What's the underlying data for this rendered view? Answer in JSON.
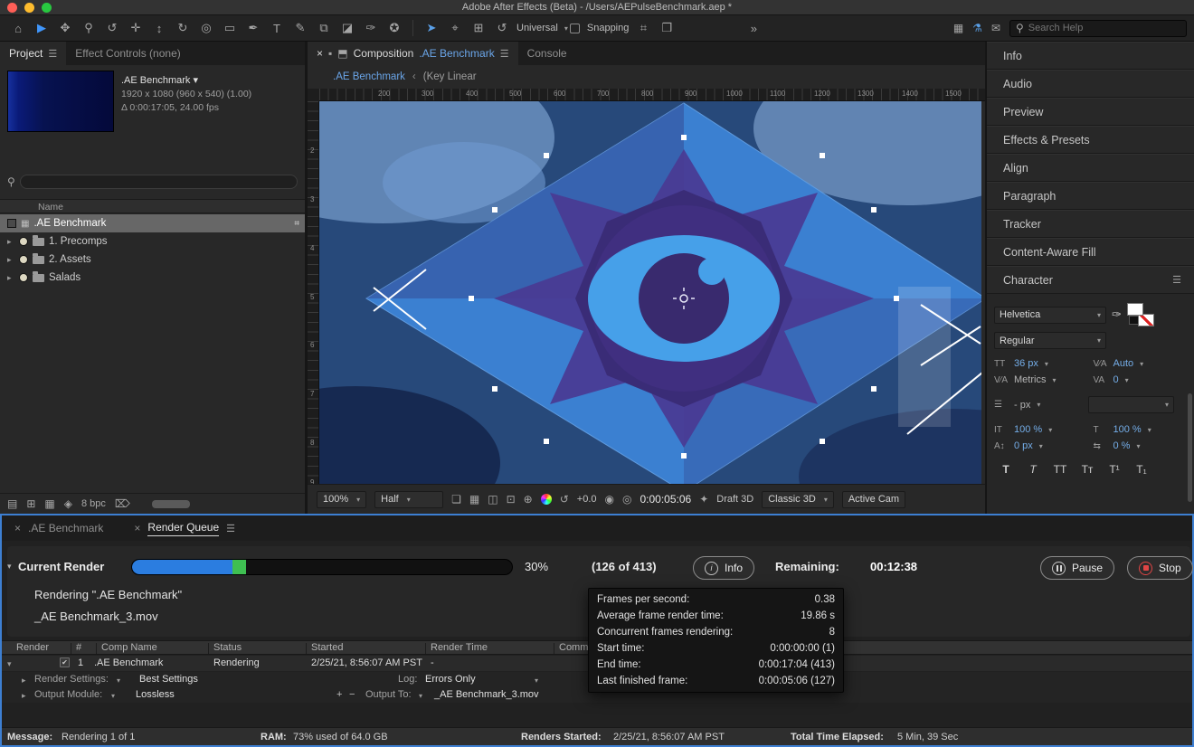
{
  "titlebar": {
    "title": "Adobe After Effects (Beta) - /Users/AEPulseBenchmark.aep *"
  },
  "toolbar": {
    "tools": [
      {
        "name": "home",
        "glyph": "⌂"
      },
      {
        "name": "selection",
        "glyph": "▶"
      },
      {
        "name": "hand",
        "glyph": "✥"
      },
      {
        "name": "zoom",
        "glyph": "⚲"
      },
      {
        "name": "orbit-camera",
        "glyph": "↺"
      },
      {
        "name": "pan-camera",
        "glyph": "✛"
      },
      {
        "name": "dolly-camera",
        "glyph": "↕"
      },
      {
        "name": "rotate",
        "glyph": "↻"
      },
      {
        "name": "pan-behind",
        "glyph": "◎"
      },
      {
        "name": "shape",
        "glyph": "▭"
      },
      {
        "name": "pen",
        "glyph": "✒"
      },
      {
        "name": "type",
        "glyph": "T"
      },
      {
        "name": "brush",
        "glyph": "✎"
      },
      {
        "name": "clone-stamp",
        "glyph": "⧉"
      },
      {
        "name": "eraser",
        "glyph": "◪"
      },
      {
        "name": "roto-brush",
        "glyph": "✑"
      },
      {
        "name": "puppet-pin",
        "glyph": "✪"
      }
    ],
    "axis_tools": [
      {
        "name": "selection-cursor",
        "glyph": "➤"
      },
      {
        "name": "local-axis-mode",
        "glyph": "⌖"
      },
      {
        "name": "world-axis-mode",
        "glyph": "⊞"
      },
      {
        "name": "reset-rotation",
        "glyph": "↺"
      }
    ],
    "universal_label": "Universal",
    "snapping_label": "Snapping",
    "snap_icons": [
      {
        "name": "snap-edges",
        "glyph": "⌗"
      },
      {
        "name": "snap-3d",
        "glyph": "❒"
      }
    ],
    "overflow": "»",
    "right_icons": [
      {
        "name": "workspace",
        "glyph": "▦"
      },
      {
        "name": "beta-feedback",
        "glyph": "⚗"
      },
      {
        "name": "comments",
        "glyph": "✉"
      }
    ],
    "search_placeholder": "Search Help"
  },
  "project_panel": {
    "tab_project": "Project",
    "tab_effect_controls": "Effect Controls (none)",
    "comp_name": ".AE Benchmark ▾",
    "comp_dimensions": "1920 x 1080  (960 x 540) (1.00)",
    "comp_duration": "Δ 0:00:17:05, 24.00 fps",
    "name_column": "Name",
    "items": [
      {
        "label": ".AE Benchmark",
        "type": "composition"
      },
      {
        "label": "1. Precomps",
        "type": "folder"
      },
      {
        "label": "2. Assets",
        "type": "folder"
      },
      {
        "label": "Salads",
        "type": "folder"
      }
    ],
    "bpc": "8 bpc"
  },
  "composition": {
    "tab_label": "Composition",
    "tab_comp_name": ".AE Benchmark",
    "tab_console": "Console",
    "breadcrumb_comp": ".AE Benchmark",
    "breadcrumb_sep": "‹",
    "breadcrumb_extra": "(Key Linear",
    "ruler_h": [
      "200",
      "300",
      "400",
      "500",
      "600",
      "700",
      "800",
      "900",
      "1000",
      "1100",
      "1200",
      "1300",
      "1400",
      "1500"
    ],
    "ruler_v": [
      "2",
      "3",
      "4",
      "5",
      "6",
      "7",
      "8",
      "9"
    ],
    "zoom": "100%",
    "resolution": "Half",
    "exposure": "+0.0",
    "timecode": "0:00:05:06",
    "draft_3d": "Draft 3D",
    "renderer": "Classic 3D",
    "camera": "Active Cam"
  },
  "right_dock": {
    "panels": [
      "Info",
      "Audio",
      "Preview",
      "Effects & Presets",
      "Align",
      "Paragraph",
      "Tracker",
      "Content-Aware Fill",
      "Character"
    ],
    "character": {
      "font_family": "Helvetica",
      "font_style": "Regular",
      "font_size": "36 px",
      "kerning": "Auto",
      "kerning_mode": "Metrics",
      "tracking": "0",
      "leading": "- px",
      "vertical_scale": "100 %",
      "horizontal_scale": "100 %",
      "baseline_shift": "0 px",
      "tsume": "0 %",
      "style_buttons": [
        "T",
        "T",
        "TT",
        "Tт",
        "T¹",
        "T₁"
      ]
    }
  },
  "render_queue": {
    "tab_comp": ".AE Benchmark",
    "tab_queue": "Render Queue",
    "current_render_label": "Current Render",
    "progress_text": "30%",
    "progress_style": "width:30%",
    "frames_text": "(126 of 413)",
    "info_button": "Info",
    "remaining_label": "Remaining:",
    "remaining_value": "00:12:38",
    "pause_button": "Pause",
    "stop_button": "Stop",
    "rendering_comp": "Rendering \".AE Benchmark\"",
    "rendering_file": "_AE Benchmark_3.mov",
    "info_tooltip": [
      {
        "label": "Frames per second:",
        "value": "0.38"
      },
      {
        "label": "Average frame render time:",
        "value": "19.86 s"
      },
      {
        "label": "Concurrent frames rendering:",
        "value": "8"
      },
      {
        "label": "Start time:",
        "value": "0:00:00:00 (1)"
      },
      {
        "label": "End time:",
        "value": "0:00:17:04 (413)"
      },
      {
        "label": "Last finished frame:",
        "value": "0:00:05:06 (127)"
      }
    ],
    "columns": [
      "Render",
      "#",
      "Comp Name",
      "Status",
      "Started",
      "Render Time",
      "Comment"
    ],
    "job": {
      "number": "1",
      "comp_name": ".AE Benchmark",
      "status": "Rendering",
      "started": "2/25/21, 8:56:07 AM PST",
      "render_time": "-"
    },
    "render_settings_label": "Render Settings:",
    "render_settings_value": "Best Settings",
    "log_label": "Log:",
    "log_value": "Errors Only",
    "output_module_label": "Output Module:",
    "output_module_value": "Lossless",
    "output_to_label": "Output To:",
    "output_to_value": "_AE Benchmark_3.mov"
  },
  "status_bar": {
    "message_label": "Message:",
    "message_value": "Rendering 1 of 1",
    "ram_label": "RAM:",
    "ram_value": "73% used of 64.0 GB",
    "renders_started_label": "Renders Started:",
    "renders_started_value": "2/25/21, 8:56:07 AM PST",
    "elapsed_label": "Total Time Elapsed:",
    "elapsed_value": "5 Min, 39 Sec"
  },
  "colors": {
    "accent_blue": "#3f8fea",
    "progress_blue": "#2b7de0",
    "progress_green": "#3fbf52",
    "stop_red": "#e04545",
    "focus_border": "#3d7fd2"
  }
}
